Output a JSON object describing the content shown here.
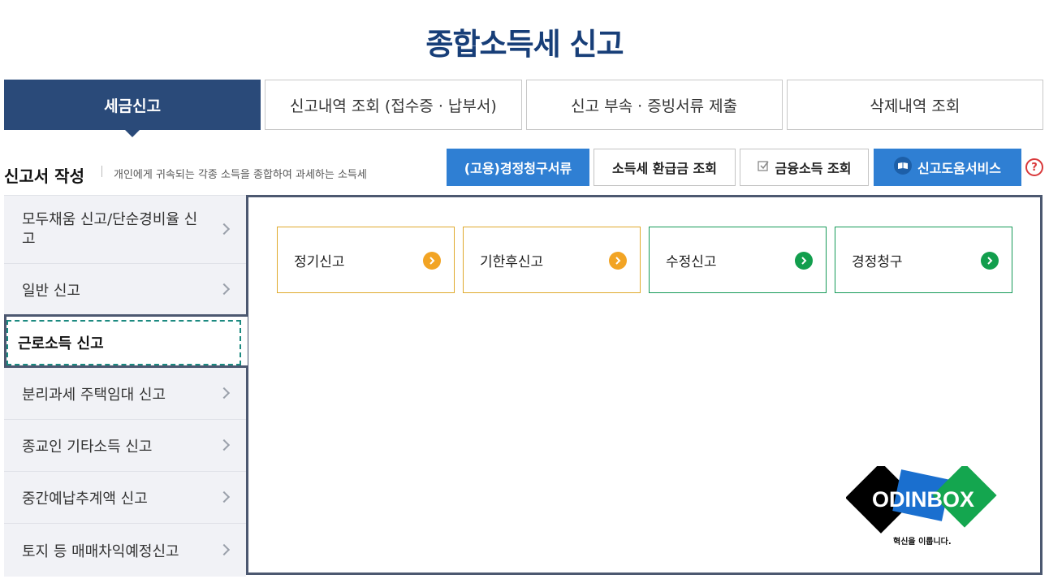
{
  "page": {
    "title": "종합소득세 신고"
  },
  "tabs": [
    {
      "label": "세금신고",
      "active": true
    },
    {
      "label": "신고내역 조회 (접수증 · 납부서)",
      "active": false
    },
    {
      "label": "신고 부속 · 증빙서류 제출",
      "active": false
    },
    {
      "label": "삭제내역 조회",
      "active": false
    }
  ],
  "subheader": {
    "title": "신고서 작성",
    "description": "개인에게 귀속되는 각종 소득을 종합하여 과세하는 소득세",
    "buttons": {
      "claim_docs": "(고용)경정청구서류",
      "refund_check": "소득세 환급금 조회",
      "financial_income": "금융소득 조회",
      "help_service": "신고도움서비스"
    },
    "help_icon_text": "?"
  },
  "sidebar": {
    "items": [
      {
        "label": "모두채움 신고/단순경비율 신고"
      },
      {
        "label": "일반 신고"
      },
      {
        "label": "근로소득 신고",
        "active": true
      },
      {
        "label": "분리과세 주택임대 신고"
      },
      {
        "label": "종교인 기타소득 신고"
      },
      {
        "label": "중간예납추계액 신고"
      },
      {
        "label": "토지 등 매매차익예정신고"
      }
    ]
  },
  "cards": [
    {
      "label": "정기신고",
      "color": "#f2a424"
    },
    {
      "label": "기한후신고",
      "color": "#f2a424"
    },
    {
      "label": "수정신고",
      "color": "#129e4d"
    },
    {
      "label": "경정청구",
      "color": "#129e4d"
    }
  ],
  "logo": {
    "text": "ODINBOX",
    "tagline": "혁신을 이룹니다."
  },
  "colors": {
    "primary": "#2a4a79",
    "button_blue": "#2f7fd3",
    "title": "#173e78",
    "frame": "#4c5870"
  }
}
